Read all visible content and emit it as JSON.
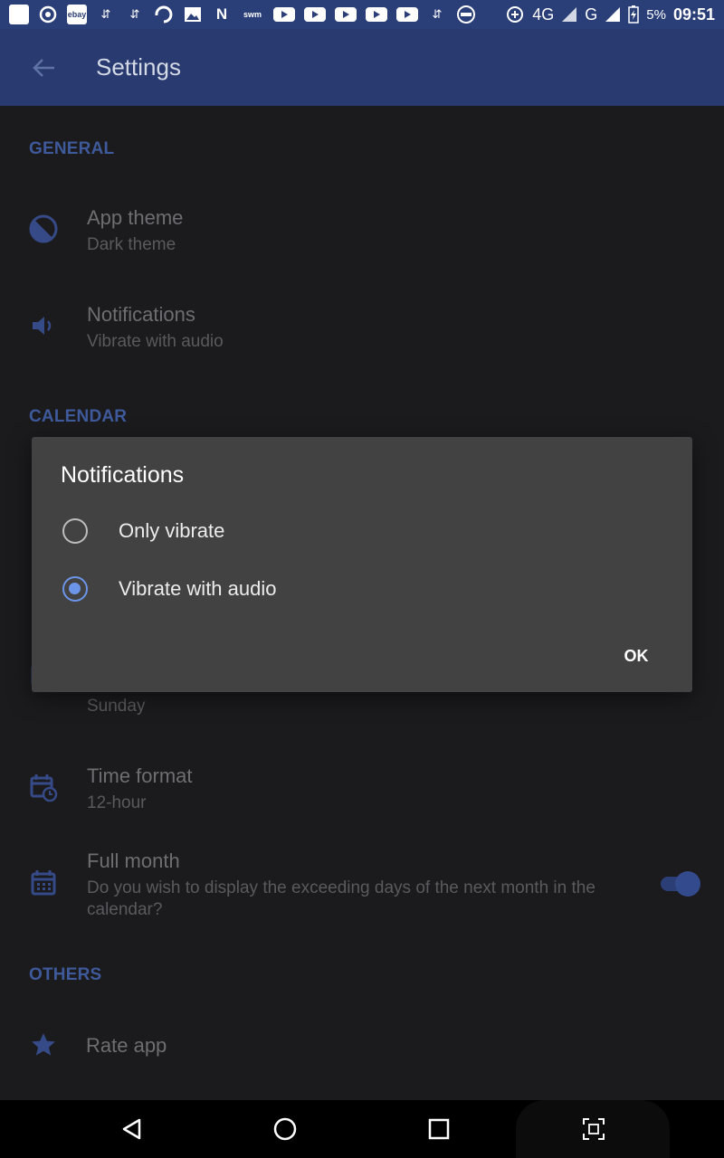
{
  "status_bar": {
    "app_icons": [
      "flipboard-icon",
      "chrome-icon",
      "ebay-icon",
      "usb-icon",
      "usb-icon",
      "swirl-icon",
      "image-icon",
      "n-icon",
      "swm-icon",
      "youtube-icon",
      "youtube-icon",
      "youtube-icon",
      "youtube-icon",
      "youtube-icon",
      "usb-icon",
      "free-icon"
    ],
    "ebay_label": "ebay",
    "swm_label": "swm",
    "network_4g": "4G",
    "network_g": "G",
    "battery": "5%",
    "time": "09:51"
  },
  "app_bar": {
    "title": "Settings"
  },
  "sections": {
    "general": "GENERAL",
    "calendar": "CALENDAR",
    "others": "OTHERS"
  },
  "general": {
    "app_theme": {
      "title": "App theme",
      "subtitle": "Dark theme"
    },
    "notifications": {
      "title": "Notifications",
      "subtitle": "Vibrate with audio"
    }
  },
  "calendar": {
    "first_day": {
      "subtitle": "Sunday"
    },
    "time_format": {
      "title": "Time format",
      "subtitle": "12-hour"
    },
    "full_month": {
      "title": "Full month",
      "subtitle": "Do you wish to display the exceeding days of the next month in the calendar?",
      "enabled": true
    }
  },
  "others": {
    "rate_app": {
      "title": "Rate app"
    }
  },
  "dialog": {
    "title": "Notifications",
    "options": [
      {
        "label": "Only vibrate",
        "selected": false
      },
      {
        "label": "Vibrate with audio",
        "selected": true
      }
    ],
    "ok_label": "OK"
  },
  "colors": {
    "accent": "#6c95e8",
    "primary_dark": "#283a6f",
    "dialog_bg": "#424242"
  }
}
